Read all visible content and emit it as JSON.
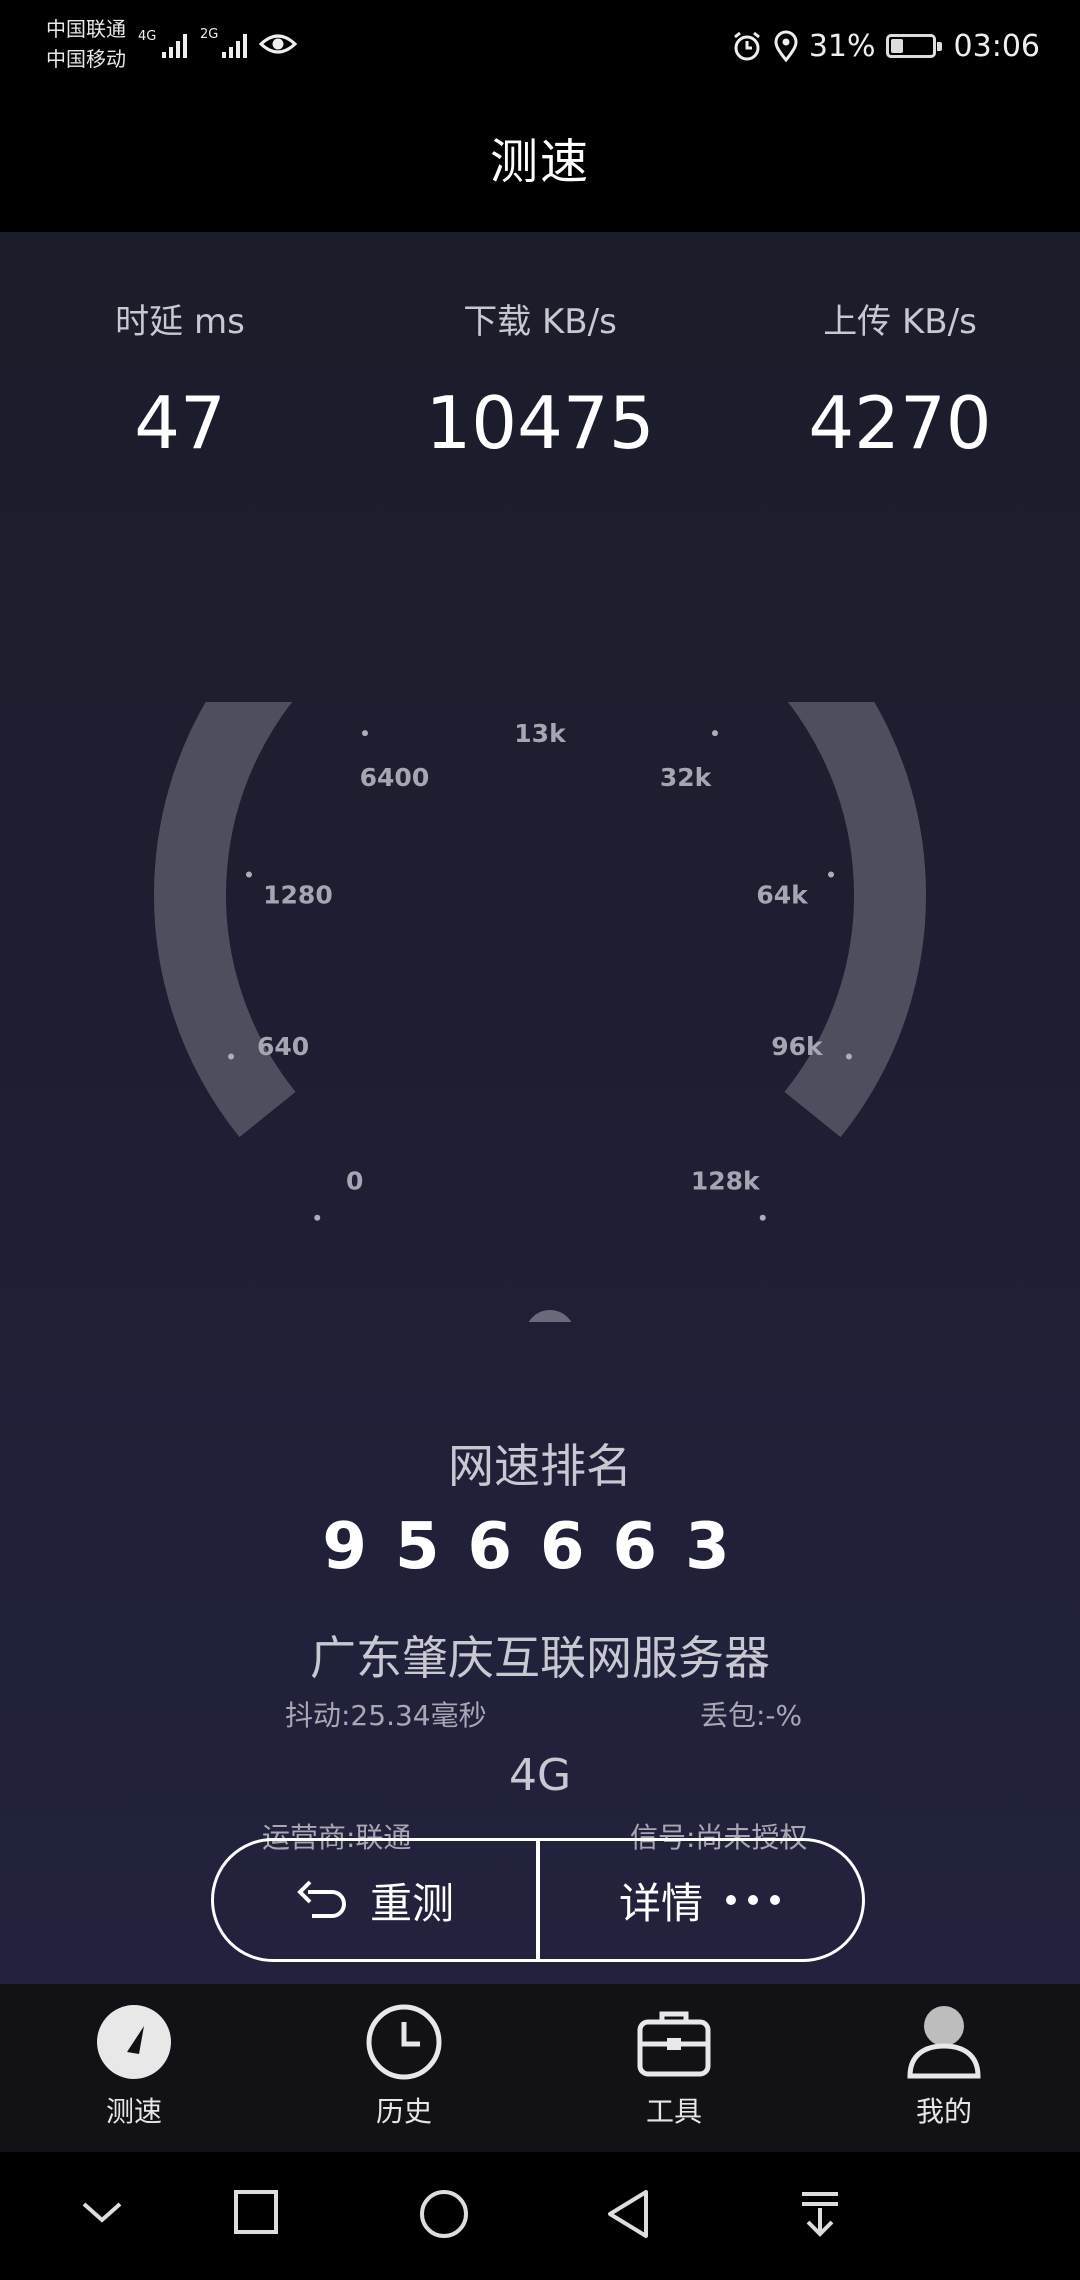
{
  "status_bar": {
    "carrier_1": "中国联通",
    "carrier_2": "中国移动",
    "net_1": "4G",
    "net_2": "2G",
    "battery_percent": "31%",
    "battery_level": 0.31,
    "time": "03:06"
  },
  "header": {
    "title": "测速"
  },
  "metrics": [
    {
      "label": "时延 ms",
      "value": "47"
    },
    {
      "label": "下载 KB/s",
      "value": "10475"
    },
    {
      "label": "上传 KB/s",
      "value": "4270"
    }
  ],
  "gauge": {
    "ticks": [
      "0",
      "640",
      "1280",
      "6400",
      "13k",
      "32k",
      "64k",
      "96k",
      "128k"
    ],
    "needle_tick_fraction": 0.12
  },
  "result": {
    "rank_title": "网速排名",
    "rank_value": "956663",
    "server": "广东肇庆互联网服务器",
    "jitter": "抖动:25.34毫秒",
    "packet_loss": "丢包:-%",
    "network_type": "4G",
    "operator": "运营商:联通",
    "signal": "信号:尚未授权"
  },
  "buttons": {
    "retest": "重测",
    "details": "详情"
  },
  "bottom_nav": [
    {
      "label": "测速",
      "icon": "speedometer-icon",
      "active": true
    },
    {
      "label": "历史",
      "icon": "clock-icon"
    },
    {
      "label": "工具",
      "icon": "toolbox-icon"
    },
    {
      "label": "我的",
      "icon": "person-icon"
    }
  ],
  "system_nav": [
    "chevron-down-icon",
    "square-icon",
    "circle-icon",
    "back-triangle-icon",
    "download-icon"
  ],
  "colors": {
    "background": "#1d1e31",
    "gauge_track": "#4e4e5e",
    "needle": "#6a6a7a",
    "text_dim": "#a8a8b4"
  }
}
